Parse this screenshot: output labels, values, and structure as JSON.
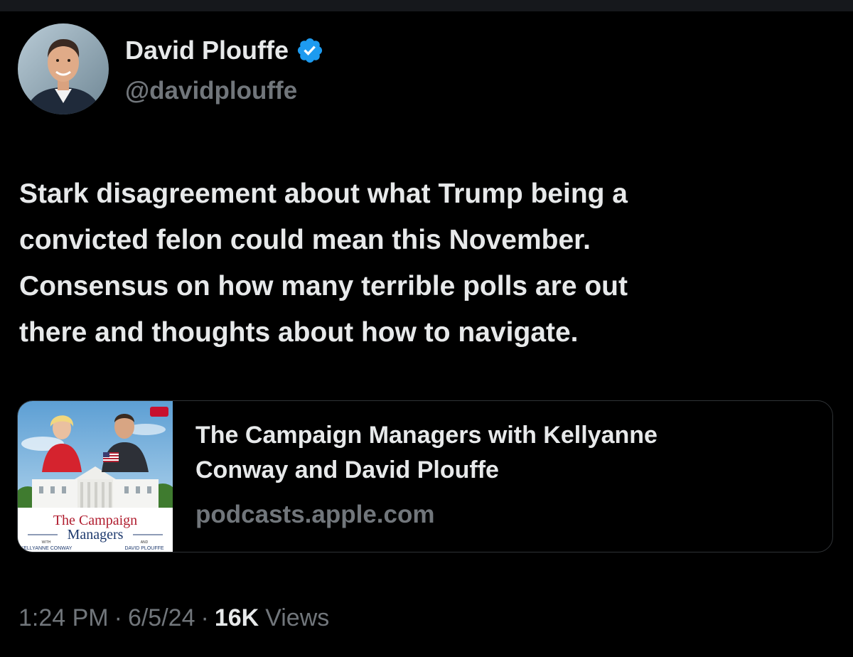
{
  "author": {
    "display_name": "David Plouffe",
    "handle": "@davidplouffe",
    "verified_icon": "verified-badge-icon",
    "avatar_icon": "avatar"
  },
  "tweet": {
    "text_lines": [
      "Stark disagreement about what Trump being a",
      "convicted felon could mean this November.",
      "Consensus on how many terrible polls are out",
      "there and thoughts about how to navigate."
    ]
  },
  "link_card": {
    "title_lines": [
      "The Campaign Managers with Kellyanne",
      "Conway and David Plouffe"
    ],
    "domain": "podcasts.apple.com",
    "thumbnail": {
      "title_line1": "The Campaign",
      "title_line2": "Managers",
      "with_label": "WITH",
      "and_label": "AND",
      "left_name": "KELLYANNE CONWAY",
      "right_name": "DAVID PLOUFFE"
    }
  },
  "meta": {
    "time": "1:24 PM",
    "separator": "·",
    "date": "6/5/24",
    "views_count": "16K",
    "views_label": "Views"
  },
  "colors": {
    "background": "#000000",
    "primary_text": "#e7e9ea",
    "secondary_text": "#71767b",
    "verified_blue": "#1d9bf0",
    "card_border": "#2f3336"
  }
}
